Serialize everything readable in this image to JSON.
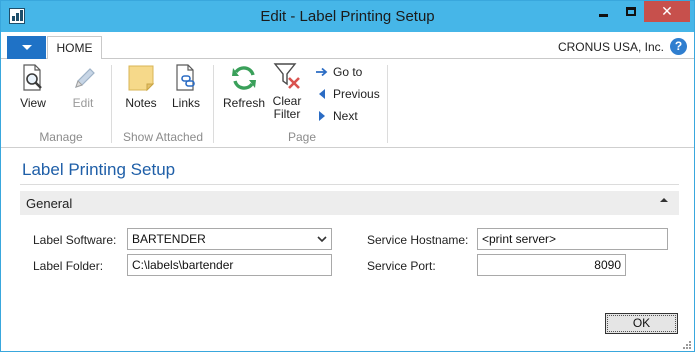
{
  "window": {
    "title": "Edit - Label Printing Setup"
  },
  "tabs": [
    {
      "label": "HOME",
      "active": true
    }
  ],
  "company": "CRONUS USA, Inc.",
  "help_icon": "?",
  "ribbon": {
    "groups": [
      {
        "label": "Manage",
        "buttons": [
          {
            "label": "View",
            "icon": "view-icon",
            "enabled": true
          },
          {
            "label": "Edit",
            "icon": "edit-icon",
            "enabled": false
          }
        ]
      },
      {
        "label": "Show Attached",
        "buttons": [
          {
            "label": "Notes",
            "icon": "notes-icon",
            "enabled": true
          },
          {
            "label": "Links",
            "icon": "links-icon",
            "enabled": true
          }
        ]
      },
      {
        "label": "Page",
        "buttons": [
          {
            "label": "Refresh",
            "icon": "refresh-icon",
            "enabled": true
          },
          {
            "label_line1": "Clear",
            "label_line2": "Filter",
            "icon": "clear-filter-icon",
            "enabled": true
          },
          {
            "label": "Go to",
            "icon": "go-to-icon",
            "enabled": true
          },
          {
            "label": "Previous",
            "icon": "previous-icon",
            "enabled": true
          },
          {
            "label": "Next",
            "icon": "next-icon",
            "enabled": true
          }
        ]
      }
    ]
  },
  "page": {
    "title": "Label Printing Setup",
    "fasttab": {
      "label": "General",
      "expanded": true
    },
    "fields": {
      "label_software": {
        "label": "Label Software:",
        "value": "BARTENDER",
        "type": "dropdown"
      },
      "label_folder": {
        "label": "Label Folder:",
        "value": "C:\\labels\\bartender"
      },
      "service_hostname": {
        "label": "Service Hostname:",
        "value": "<print server>"
      },
      "service_port": {
        "label": "Service Port:",
        "value": "8090"
      }
    }
  },
  "footer": {
    "ok_label": "OK"
  },
  "colors": {
    "titlebar": "#46b6e8",
    "close_button": "#c7504c",
    "app_menu": "#1f72c6",
    "page_title": "#1f5fa8",
    "refresh_green": "#3aa05a",
    "clear_filter_red": "#d9534f",
    "nav_blue": "#2b6cc4"
  }
}
